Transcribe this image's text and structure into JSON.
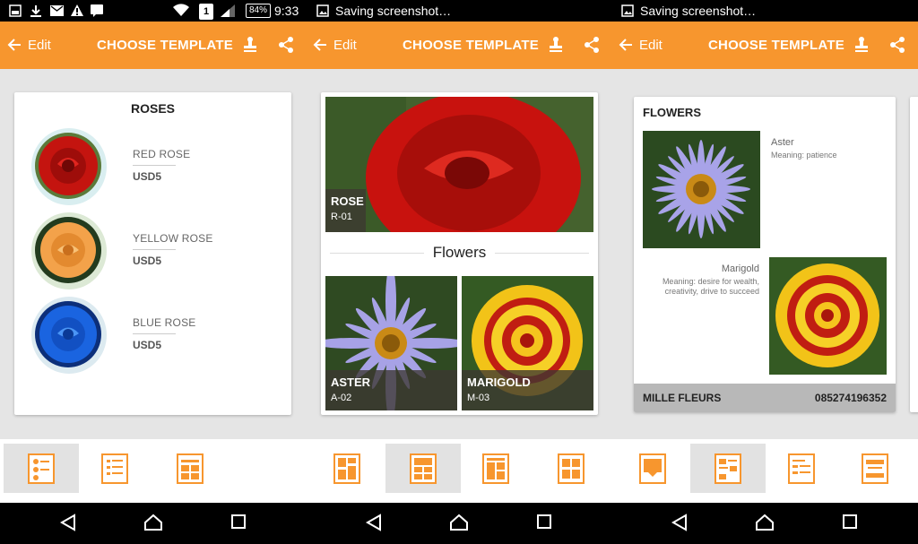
{
  "status": {
    "time": "9:33",
    "battery": "84%",
    "sim": "1",
    "notification_p2": "Saving screenshot…",
    "notification_p3": "Saving screenshot…"
  },
  "appbar": {
    "back_label": "Edit",
    "title": "CHOOSE TEMPLATE",
    "accent_color": "#f7962e"
  },
  "panel1": {
    "title": "ROSES",
    "items": [
      {
        "name": "RED ROSE",
        "price": "USD5",
        "color": "#c4140f"
      },
      {
        "name": "YELLOW ROSE",
        "price": "USD5",
        "color": "#f3a24a"
      },
      {
        "name": "BLUE ROSE",
        "price": "USD5",
        "color": "#1a64e0"
      }
    ]
  },
  "panel2": {
    "hero": {
      "name": "ROSE",
      "code": "R-01"
    },
    "section_title": "Flowers",
    "tiles": [
      {
        "name": "ASTER",
        "code": "A-02"
      },
      {
        "name": "MARIGOLD",
        "code": "M-03"
      }
    ]
  },
  "panel3": {
    "title": "FLOWERS",
    "items": [
      {
        "name": "Aster",
        "meaning": "Meaning: patience"
      },
      {
        "name": "Marigold",
        "meaning": "Meaning: desire for wealth, creativity, drive to succeed"
      }
    ],
    "footer_name": "MILLE FLEURS",
    "footer_phone": "085274196352"
  },
  "tabs": {
    "panel1": [
      "template-list-icon",
      "template-text-icon",
      "template-grid-icon"
    ],
    "panel2": [
      "template-split-icon",
      "template-grid-icon",
      "template-mosaic-icon",
      "template-blocks-icon"
    ],
    "panel3": [
      "template-hero-icon",
      "template-list-icon",
      "template-text-icon",
      "template-card-icon"
    ]
  }
}
